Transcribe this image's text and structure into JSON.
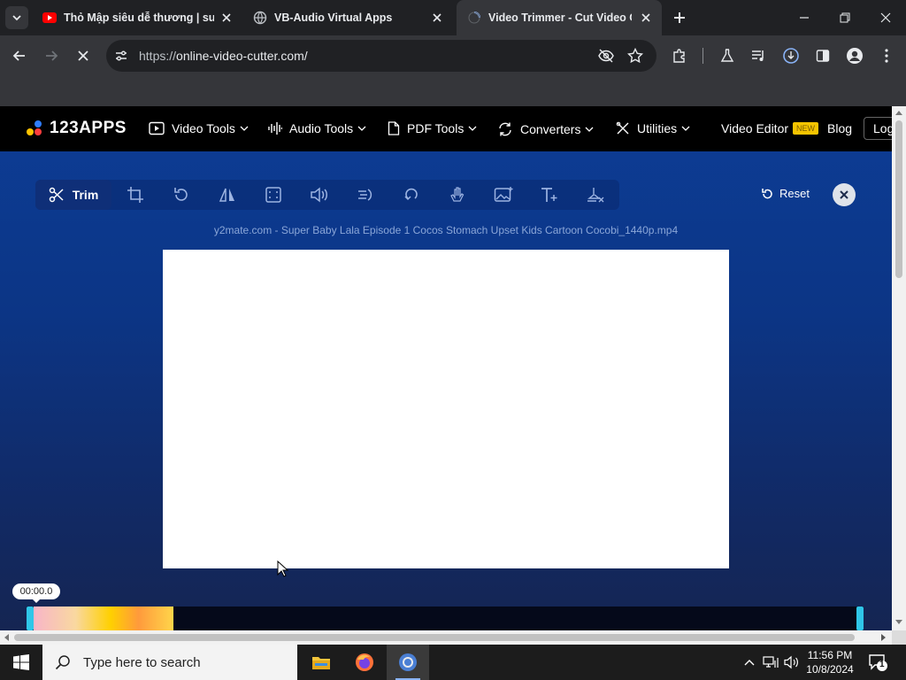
{
  "browser": {
    "tabs": [
      {
        "title": "Thỏ Mập siêu dễ thương | sup",
        "favicon": "youtube-icon"
      },
      {
        "title": "VB-Audio Virtual Apps",
        "favicon": "globe-icon"
      },
      {
        "title": "Video Trimmer - Cut Video Onl",
        "favicon": "loading-icon"
      }
    ],
    "active_tab": 2,
    "url_scheme": "https://",
    "url_rest": "online-video-cutter.com/"
  },
  "site": {
    "logo": "123APPS",
    "nav": [
      {
        "label": "Video Tools"
      },
      {
        "label": "Audio Tools"
      },
      {
        "label": "PDF Tools"
      },
      {
        "label": "Converters"
      },
      {
        "label": "Utilities"
      }
    ],
    "video_editor": "Video Editor",
    "new_badge": "NEW",
    "blog": "Blog",
    "login": "Log"
  },
  "editor": {
    "trim_label": "Trim",
    "reset_label": "Reset",
    "filename": "y2mate.com - Super Baby Lala Episode 1 Cocos Stomach Upset Kids Cartoon Cocobi_1440p.mp4",
    "timecode": "00:00.0"
  },
  "taskbar": {
    "search_placeholder": "Type here to search",
    "time": "11:56 PM",
    "date": "10/8/2024",
    "notification_count": "1"
  }
}
